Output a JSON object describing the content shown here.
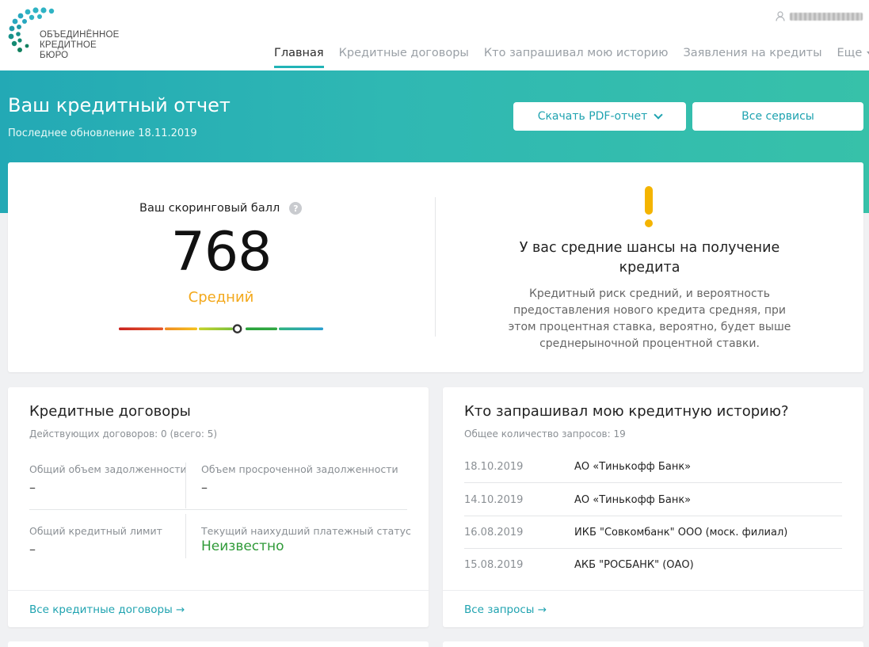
{
  "header": {
    "logo_line1": "ОБЪЕДИНЁННОЕ",
    "logo_line2": "КРЕДИТНОЕ БЮРО",
    "nav": [
      {
        "label": "Главная",
        "active": true
      },
      {
        "label": "Кредитные договоры",
        "active": false
      },
      {
        "label": "Кто запрашивал мою историю",
        "active": false
      },
      {
        "label": "Заявления на кредиты",
        "active": false
      },
      {
        "label": "Еще",
        "active": false
      }
    ]
  },
  "banner": {
    "title": "Ваш кредитный отчет",
    "subtitle": "Последнее обновление 18.11.2019",
    "pdf_button": "Скачать PDF-отчет",
    "all_services_button": "Все сервисы"
  },
  "score": {
    "label": "Ваш скоринговый балл",
    "help": "?",
    "value": "768",
    "grade": "Средний",
    "scale_position_fraction": 0.58
  },
  "chance": {
    "title": "У вас средние шансы на получение кредита",
    "text": "Кредитный риск средний, и вероятность предоставления нового кредита средняя, при этом процентная ставка, вероятно, будет выше среднерыночной процентной ставки."
  },
  "loans": {
    "title": "Кредитные договоры",
    "subtitle": "Действующих договоров: 0 (всего: 5)",
    "total_debt_label": "Общий объем задолженности",
    "total_debt_value": "–",
    "overdue_label": "Объем просроченной задолженности",
    "overdue_value": "–",
    "limit_label": "Общий кредитный лимит",
    "limit_value": "–",
    "status_label": "Текущий наихудший платежный статус",
    "status_value": "Неизвестно",
    "link": "Все кредитные договоры →"
  },
  "requests": {
    "title": "Кто запрашивал мою кредитную историю?",
    "subtitle": "Общее количество запросов: 19",
    "rows": [
      {
        "date": "18.10.2019",
        "bank": "АО «Тинькофф Банк»"
      },
      {
        "date": "14.10.2019",
        "bank": "АО «Тинькофф Банк»"
      },
      {
        "date": "16.08.2019",
        "bank": "ИКБ \"Совкомбанк\" ООО (моск. филиал)"
      },
      {
        "date": "15.08.2019",
        "bank": "АКБ \"РОСБАНК\" (ОАО)"
      }
    ],
    "link": "Все запросы →"
  },
  "colors": {
    "accent": "#21b3b6",
    "grade": "#f3a81b",
    "status": "#2f9a38",
    "warning": "#f4b400"
  }
}
